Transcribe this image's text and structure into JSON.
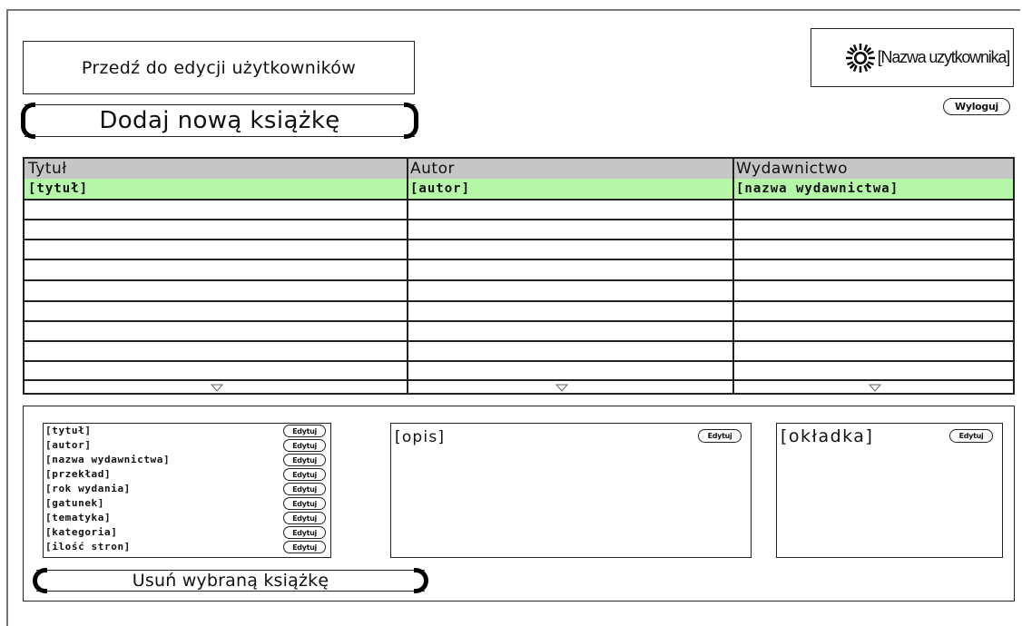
{
  "header": {
    "edit_users_label": "Przedź do edycji użytkowników",
    "add_book_label": "Dodaj nową  książkę",
    "username": "[Nazwa uzytkownika]",
    "user_icon": "sun-icon",
    "logout_label": "Wyloguj"
  },
  "table": {
    "columns": [
      "Tytuł",
      "Autor",
      "Wydawnictwo"
    ],
    "selected_row": [
      "[tytuł]",
      "[autor]",
      "[nazwa wydawnictwa]"
    ],
    "selected_row_color": "#b6f6a8",
    "header_color": "#c6c6c6"
  },
  "details": {
    "fields": [
      "[tytuł]",
      "[autor]",
      "[nazwa wydawnictwa]",
      "[przekład]",
      "[rok wydania]",
      "[gatunek]",
      "[tematyka]",
      "[kategoria]",
      "[ilość stron]"
    ],
    "edit_label": "Edytuj",
    "description_label": "[opis]",
    "cover_label": "[okładka]",
    "delete_book_label": "Usuń wybraną  książkę"
  }
}
